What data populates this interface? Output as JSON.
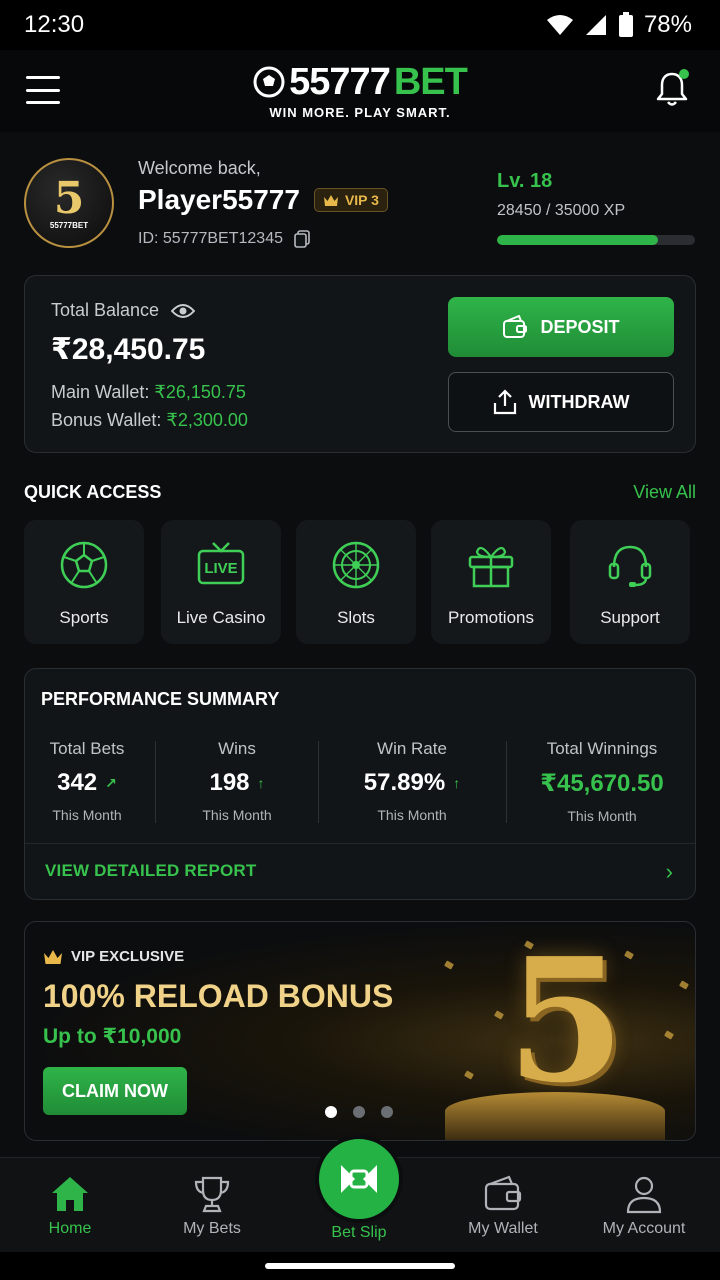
{
  "status": {
    "time": "12:30",
    "battery": "78%"
  },
  "brand": {
    "num": "55777",
    "bet": "BET",
    "tagline": "WIN MORE. PLAY SMART."
  },
  "profile": {
    "avatar_number": "5",
    "avatar_text": "55777BET",
    "welcome": "Welcome back,",
    "username": "Player55777",
    "vip": "VIP 3",
    "id": "ID: 55777BET12345",
    "level": "Lv. 18",
    "xp": "28450 / 35000 XP",
    "xp_progress": 0.813
  },
  "balance": {
    "label": "Total Balance",
    "total": "₹28,450.75",
    "main_label": "Main Wallet:",
    "main_value": "₹26,150.75",
    "bonus_label": "Bonus Wallet:",
    "bonus_value": "₹2,300.00",
    "deposit": "DEPOSIT",
    "withdraw": "WITHDRAW"
  },
  "quick_access": {
    "title": "QUICK ACCESS",
    "view_all": "View All",
    "items": [
      {
        "label": "Sports",
        "icon": "soccer-ball-icon"
      },
      {
        "label": "Live Casino",
        "icon": "live-tv-icon"
      },
      {
        "label": "Slots",
        "icon": "roulette-icon"
      },
      {
        "label": "Promotions",
        "icon": "gift-icon"
      },
      {
        "label": "Support",
        "icon": "headset-icon"
      }
    ]
  },
  "performance": {
    "title": "PERFORMANCE SUMMARY",
    "stats": [
      {
        "heading": "Total Bets",
        "value": "342",
        "sub": "This Month"
      },
      {
        "heading": "Wins",
        "value": "198",
        "sub": "This Month"
      },
      {
        "heading": "Win Rate",
        "value": "57.89%",
        "sub": "This Month"
      },
      {
        "heading": "Total Winnings",
        "value": "₹45,670.50",
        "sub": "This Month"
      }
    ],
    "report_link": "VIEW DETAILED REPORT"
  },
  "promo": {
    "exclusive": "VIP EXCLUSIVE",
    "title": "100% RELOAD BONUS",
    "subtitle": "Up to ₹10,000",
    "cta": "CLAIM NOW",
    "big_number": "5"
  },
  "nav": {
    "home": "Home",
    "my_bets": "My Bets",
    "bet_slip": "Bet Slip",
    "my_wallet": "My Wallet",
    "my_account": "My Account"
  },
  "colors": {
    "accent": "#36c24c",
    "gold": "#e8b84a",
    "background": "#0b0d0f"
  }
}
